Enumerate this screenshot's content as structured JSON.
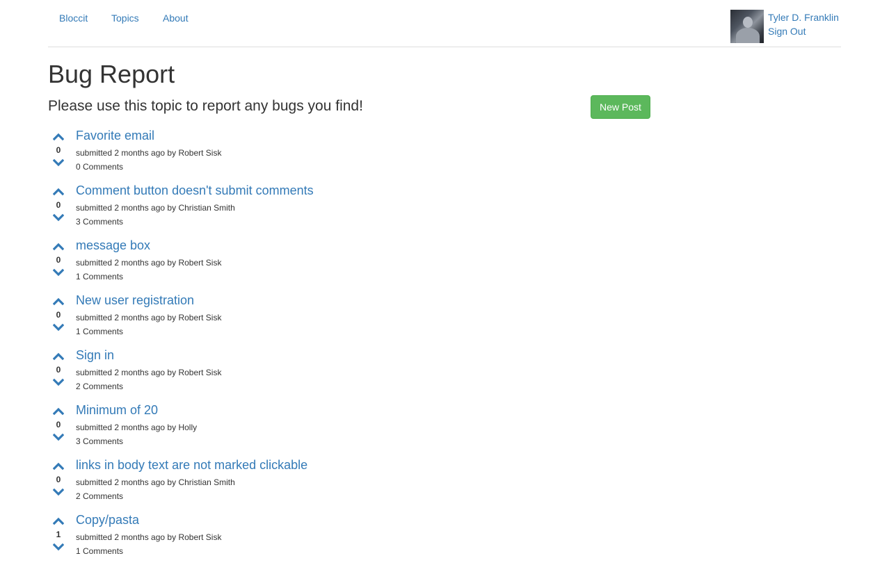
{
  "nav": {
    "links": [
      {
        "label": "Bloccit"
      },
      {
        "label": "Topics"
      },
      {
        "label": "About"
      }
    ],
    "user": {
      "name": "Tyler D. Franklin",
      "sign_out": "Sign Out"
    }
  },
  "topic": {
    "title": "Bug Report",
    "description": "Please use this topic to report any bugs you find!",
    "new_post_label": "New Post"
  },
  "posts": [
    {
      "title": "Favorite email",
      "votes": "0",
      "meta_prefix": "submitted 2 months ago by",
      "author": "Robert Sisk",
      "comments": "0 Comments"
    },
    {
      "title": "Comment button doesn't submit comments",
      "votes": "0",
      "meta_prefix": "submitted 2 months ago by",
      "author": "Christian Smith",
      "comments": "3 Comments"
    },
    {
      "title": "message box",
      "votes": "0",
      "meta_prefix": "submitted 2 months ago by",
      "author": "Robert Sisk",
      "comments": "1 Comments"
    },
    {
      "title": "New user registration",
      "votes": "0",
      "meta_prefix": "submitted 2 months ago by",
      "author": "Robert Sisk",
      "comments": "1 Comments"
    },
    {
      "title": "Sign in",
      "votes": "0",
      "meta_prefix": "submitted 2 months ago by",
      "author": "Robert Sisk",
      "comments": "2 Comments"
    },
    {
      "title": "Minimum of 20",
      "votes": "0",
      "meta_prefix": "submitted 2 months ago by",
      "author": "Holly",
      "comments": "3 Comments"
    },
    {
      "title": "links in body text are not marked clickable",
      "votes": "0",
      "meta_prefix": "submitted 2 months ago by",
      "author": "Christian Smith",
      "comments": "2 Comments"
    },
    {
      "title": "Copy/pasta",
      "votes": "1",
      "meta_prefix": "submitted 2 months ago by",
      "author": "Robert Sisk",
      "comments": "1 Comments"
    }
  ],
  "colors": {
    "link": "#337ab7",
    "success": "#5cb85c",
    "text": "#333333",
    "divider": "#dddddd"
  }
}
